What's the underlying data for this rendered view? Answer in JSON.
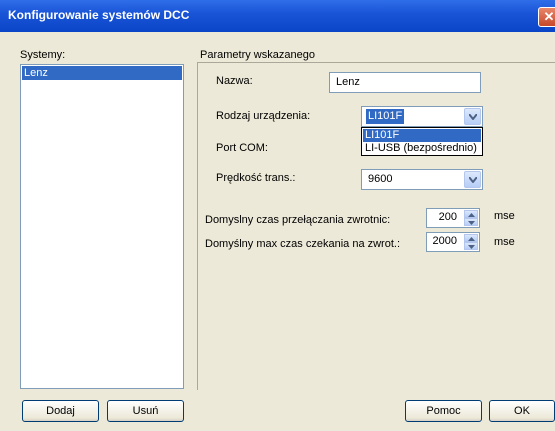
{
  "window": {
    "title": "Konfigurowanie systemów DCC",
    "close_glyph": "✕"
  },
  "systems": {
    "label": "Systemy:",
    "items": [
      "Lenz"
    ]
  },
  "params": {
    "group_label": "Parametry wskazanego",
    "name": {
      "label": "Nazwa:",
      "value": "Lenz"
    },
    "device_type": {
      "label": "Rodzaj urządzenia:",
      "value": "LI101F",
      "options": [
        "LI101F",
        "LI-USB (bezpośrednio)"
      ]
    },
    "com_port": {
      "label": "Port COM:"
    },
    "speed": {
      "label": "Prędkość trans.:",
      "value": "9600"
    },
    "switch_time": {
      "label": "Domyslny czas przełączania zwrotnic:",
      "value": "200",
      "unit": "mse"
    },
    "max_wait": {
      "label": "Domyślny max czas czekania na zwrot.:",
      "value": "2000",
      "unit": "mse"
    }
  },
  "buttons": {
    "add": "Dodaj",
    "remove": "Usuń",
    "help": "Pomoc",
    "ok": "OK"
  },
  "colors": {
    "title_bar": "#1a55d8",
    "selection": "#316ac5",
    "dialog_bg": "#ece9d8"
  }
}
